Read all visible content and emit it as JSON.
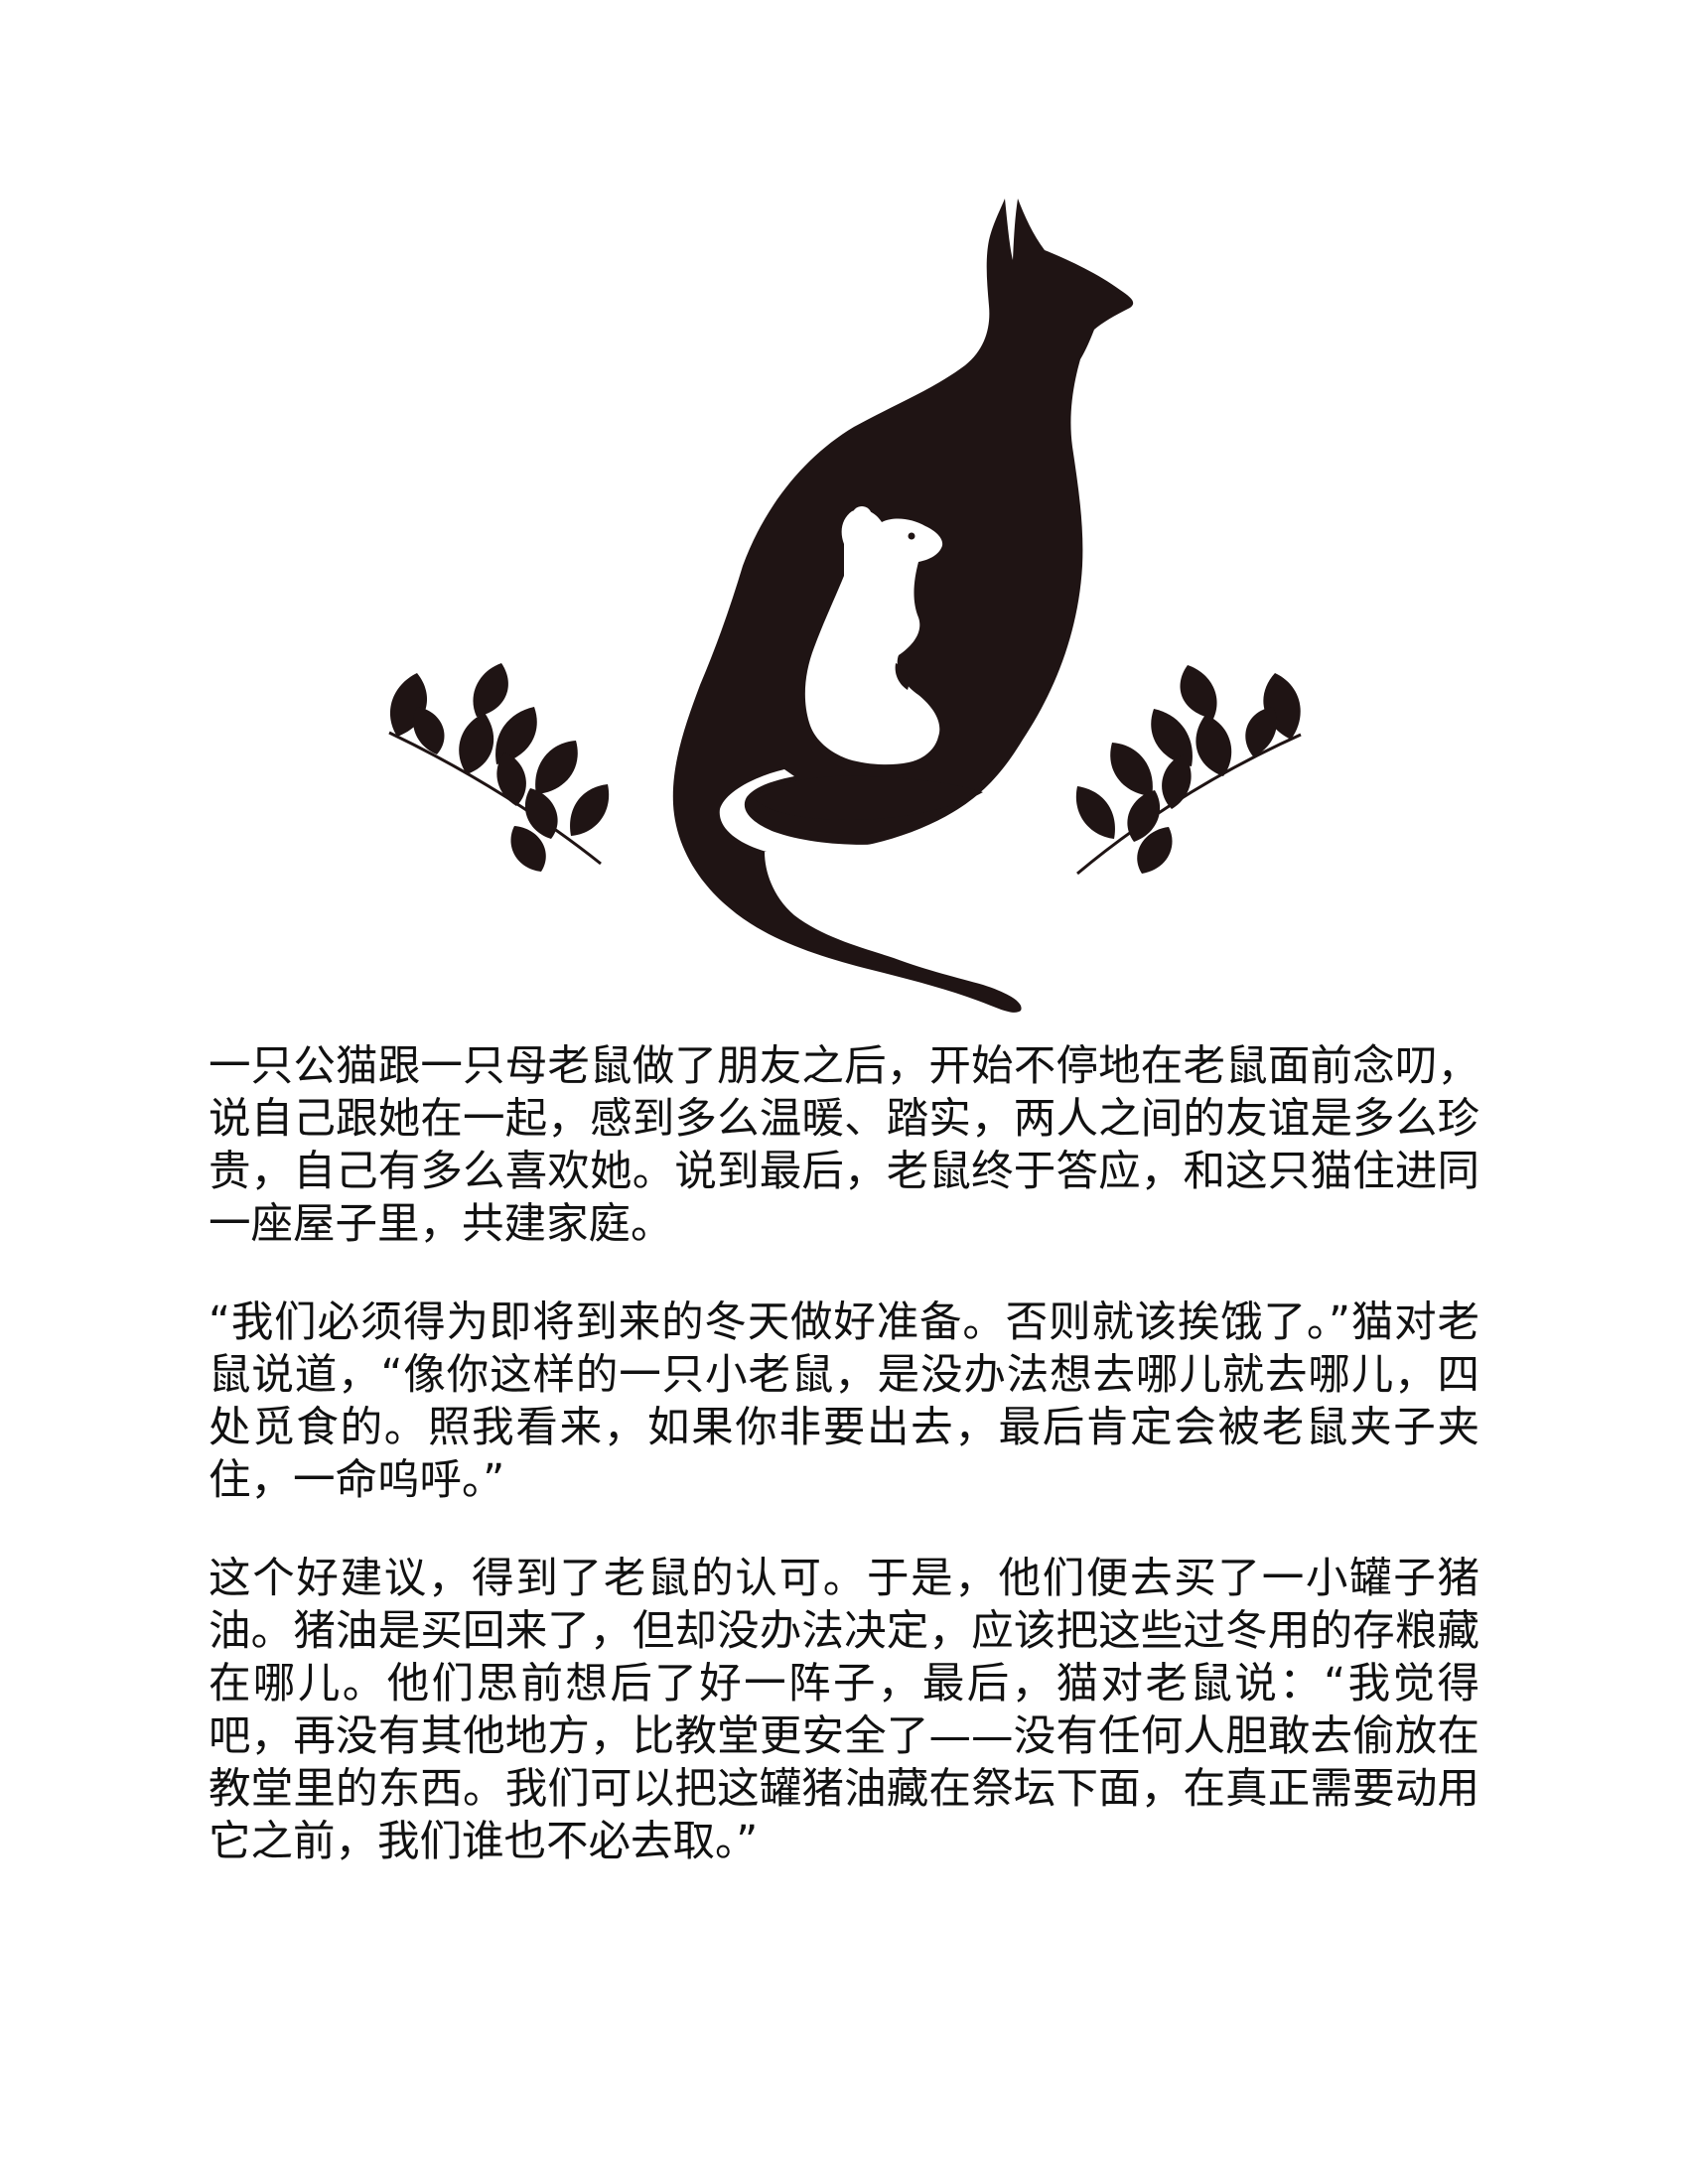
{
  "illustration": {
    "cat_color": "#1f1414",
    "mouse_color": "#ffffff",
    "leaf_color": "#1f1414",
    "icons": [
      "cat-silhouette-icon",
      "mouse-silhouette-icon",
      "leaf-branch-icon"
    ]
  },
  "story": {
    "paragraphs": [
      "一只公猫跟一只母老鼠做了朋友之后，开始不停地在老鼠面前念叨，说自己跟她在一起，感到多么温暖、踏实，两人之间的友谊是多么珍贵，自己有多么喜欢她。说到最后，老鼠终于答应，和这只猫住进同一座屋子里，共建家庭。",
      "“我们必须得为即将到来的冬天做好准备。否则就该挨饿了。”猫对老鼠说道，“像你这样的一只小老鼠，是没办法想去哪儿就去哪儿，四处觅食的。照我看来，如果你非要出去，最后肯定会被老鼠夹子夹住，一命呜呼。”",
      "这个好建议，得到了老鼠的认可。于是，他们便去买了一小罐子猪油。猪油是买回来了，但却没办法决定，应该把这些过冬用的存粮藏在哪儿。他们思前想后了好一阵子，最后，猫对老鼠说：“我觉得吧，再没有其他地方，比教堂更安全了——没有任何人胆敢去偷放在教堂里的东西。我们可以把这罐猪油藏在祭坛下面，在真正需要动用它之前，我们谁也不必去取。”"
    ]
  }
}
